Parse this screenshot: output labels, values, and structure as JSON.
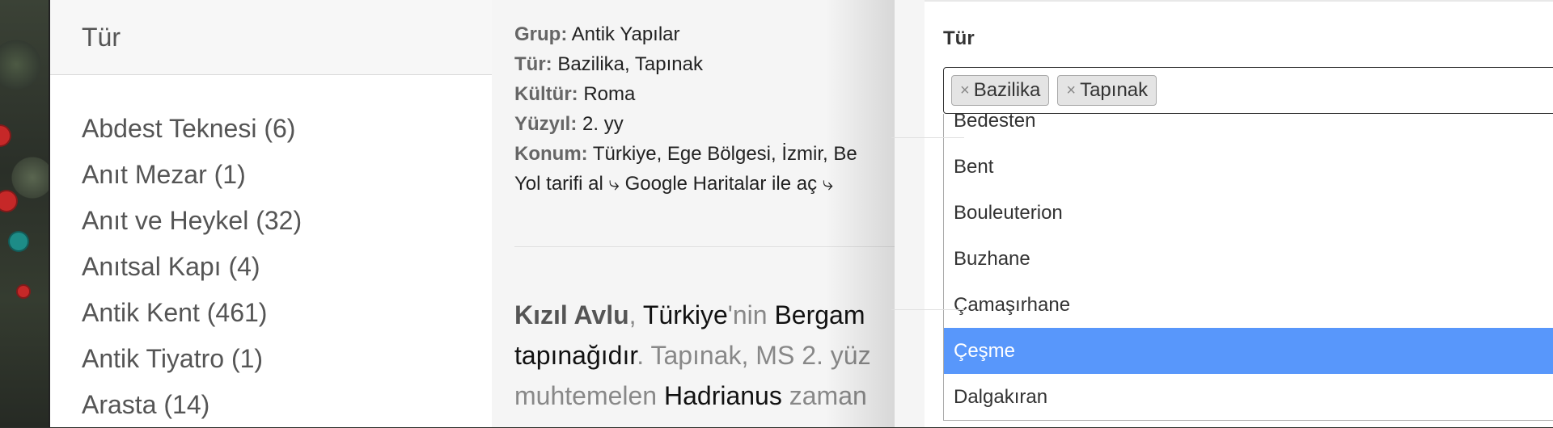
{
  "left_panel": {
    "header": "Tür",
    "items": [
      "Abdest Teknesi (6)",
      "Anıt Mezar (1)",
      "Anıt ve Heykel (32)",
      "Anıtsal Kapı (4)",
      "Antik Kent (461)",
      "Antik Tiyatro (1)",
      "Arasta (14)"
    ]
  },
  "details": {
    "group_key": "Grup:",
    "group_value": "Antik Yapılar",
    "type_key": "Tür:",
    "type_value": "Bazilika, Tapınak",
    "culture_key": "Kültür:",
    "culture_value": "Roma",
    "century_key": "Yüzyıl:",
    "century_value": "2. yy",
    "location_key": "Konum:",
    "location_value": "Türkiye, Ege Bölgesi, İzmir, Be",
    "directions_link": "Yol tarifi al ⤷",
    "maps_link": "Google Haritalar ile aç ⤷"
  },
  "article": {
    "line1_bold": "Kızıl Avlu",
    "line1_sep": ", ",
    "line1_link1": "Türkiye",
    "line1_mid": "'nin ",
    "line1_link2": "Bergam",
    "line2_link": "tapınağıdır",
    "line2_rest": ". Tapınak, MS 2. yüz",
    "line3_start": "muhtemelen ",
    "line3_link": "Hadrianus",
    "line3_rest": " zaman"
  },
  "filter": {
    "label": "Tür",
    "selected_tags": [
      "Bazilika",
      "Tapınak"
    ],
    "remove_symbol": "×",
    "options": [
      {
        "label": "Bedesten",
        "highlighted": false
      },
      {
        "label": "Bent",
        "highlighted": false
      },
      {
        "label": "Bouleuterion",
        "highlighted": false
      },
      {
        "label": "Buzhane",
        "highlighted": false
      },
      {
        "label": "Çamaşırhane",
        "highlighted": false
      },
      {
        "label": "Çeşme",
        "highlighted": true
      },
      {
        "label": "Dalgakıran",
        "highlighted": false
      }
    ]
  },
  "colors": {
    "highlight": "#5897fb",
    "marker_red": "#c62828",
    "marker_teal": "#1d8c87"
  }
}
